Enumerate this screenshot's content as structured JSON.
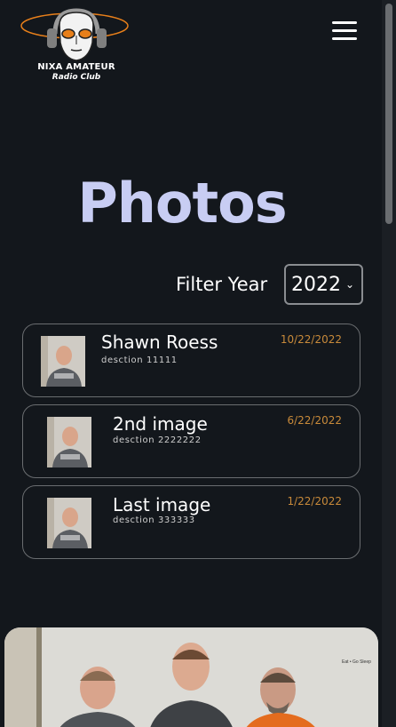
{
  "header": {
    "logo_line1": "NIXA AMATEUR",
    "logo_line2": "Radio Club",
    "menu_icon": "hamburger-icon"
  },
  "page": {
    "title": "Photos"
  },
  "filter": {
    "label": "Filter Year",
    "selected_year": "2022"
  },
  "photos": [
    {
      "name": "Shawn Roess",
      "description": "desction 11111",
      "date": "10/22/2022"
    },
    {
      "name": "2nd image",
      "description": "desction 2222222",
      "date": "6/22/2022"
    },
    {
      "name": "Last image",
      "description": "desction 333333",
      "date": "1/22/2022"
    }
  ],
  "colors": {
    "background": "#13171c",
    "title": "#c8cdf3",
    "date": "#c88a3a",
    "card_border": "#6a6d70",
    "logo_ring": "#e77f1a"
  }
}
